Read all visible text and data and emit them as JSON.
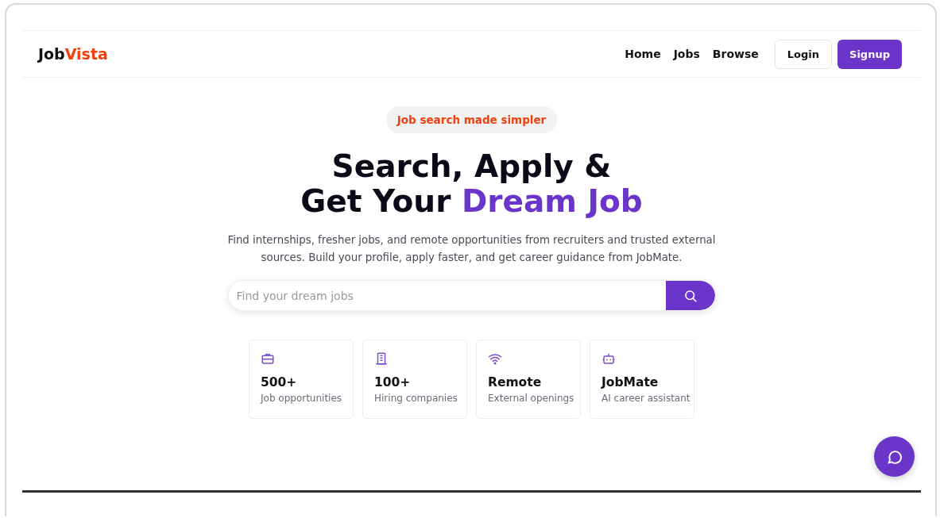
{
  "logo": {
    "part_1": "Job",
    "part_2": "Vista"
  },
  "nav": {
    "links": [
      "Home",
      "Jobs",
      "Browse"
    ],
    "login": "Login",
    "signup": "Signup"
  },
  "hero": {
    "badge": "Job search made simpler",
    "title_line_1": "Search, Apply &",
    "title_line_2_plain": "Get Your",
    "title_line_2_accent": "Dream Job",
    "description": "Find internships, fresher jobs, and remote opportunities from recruiters and trusted external sources. Build your profile, apply faster, and get career guidance from JobMate."
  },
  "search": {
    "placeholder": "Find your dream jobs"
  },
  "stats": [
    {
      "value": "500+",
      "label": "Job opportunities"
    },
    {
      "value": "100+",
      "label": "Hiring companies"
    },
    {
      "value": "Remote",
      "label": "External openings"
    },
    {
      "value": "JobMate",
      "label": "AI career assistant"
    }
  ]
}
